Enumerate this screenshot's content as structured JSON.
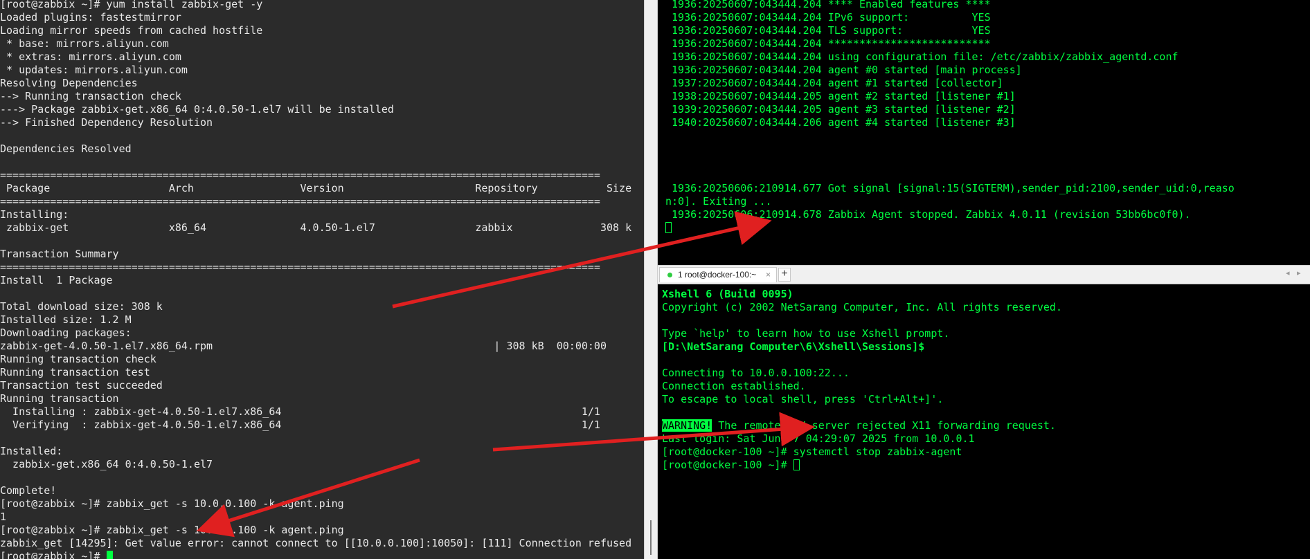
{
  "left_terminal": {
    "lines": [
      "[root@zabbix ~]# yum install zabbix-get -y",
      "Loaded plugins: fastestmirror",
      "Loading mirror speeds from cached hostfile",
      " * base: mirrors.aliyun.com",
      " * extras: mirrors.aliyun.com",
      " * updates: mirrors.aliyun.com",
      "Resolving Dependencies",
      "--> Running transaction check",
      "---> Package zabbix-get.x86_64 0:4.0.50-1.el7 will be installed",
      "--> Finished Dependency Resolution",
      "",
      "Dependencies Resolved",
      "",
      "================================================================================================",
      " Package                   Arch                 Version                     Repository           Size",
      "================================================================================================",
      "Installing:",
      " zabbix-get                x86_64               4.0.50-1.el7                zabbix              308 k",
      "",
      "Transaction Summary",
      "================================================================================================",
      "Install  1 Package",
      "",
      "Total download size: 308 k",
      "Installed size: 1.2 M",
      "Downloading packages:",
      "zabbix-get-4.0.50-1.el7.x86_64.rpm                                             | 308 kB  00:00:00",
      "Running transaction check",
      "Running transaction test",
      "Transaction test succeeded",
      "Running transaction",
      "  Installing : zabbix-get-4.0.50-1.el7.x86_64                                                1/1",
      "  Verifying  : zabbix-get-4.0.50-1.el7.x86_64                                                1/1",
      "",
      "Installed:",
      "  zabbix-get.x86_64 0:4.0.50-1.el7",
      "",
      "Complete!",
      "[root@zabbix ~]# zabbix_get -s 10.0.0.100 -k agent.ping",
      "1",
      "[root@zabbix ~]# zabbix_get -s 10.0.0.100 -k agent.ping",
      "zabbix_get [14295]: Get value error: cannot connect to [[10.0.0.100]:10050]: [111] Connection refused",
      "[root@zabbix ~]# "
    ]
  },
  "right_top_terminal": {
    "lines": [
      " 1936:20250607:043444.204 **** Enabled features ****",
      " 1936:20250607:043444.204 IPv6 support:          YES",
      " 1936:20250607:043444.204 TLS support:           YES",
      " 1936:20250607:043444.204 **************************",
      " 1936:20250607:043444.204 using configuration file: /etc/zabbix/zabbix_agentd.conf",
      " 1936:20250607:043444.204 agent #0 started [main process]",
      " 1937:20250607:043444.204 agent #1 started [collector]",
      " 1938:20250607:043444.205 agent #2 started [listener #1]",
      " 1939:20250607:043444.205 agent #3 started [listener #2]",
      " 1940:20250607:043444.206 agent #4 started [listener #3]",
      "",
      "",
      "",
      "",
      " 1936:20250606:210914.677 Got signal [signal:15(SIGTERM),sender_pid:2100,sender_uid:0,reaso",
      "n:0]. Exiting ...",
      " 1936:20250606:210914.678 Zabbix Agent stopped. Zabbix 4.0.11 (revision 53bb6bc0f0).",
      ""
    ]
  },
  "tab_bar": {
    "tab_label": "1 root@docker-100:~",
    "tab_close": "×",
    "add_tab": "+",
    "nav_prev": "◂",
    "nav_next": "▸"
  },
  "right_bottom_terminal": {
    "lines": [
      "Xshell 6 (Build 0095)",
      "Copyright (c) 2002 NetSarang Computer, Inc. All rights reserved.",
      "",
      "Type `help' to learn how to use Xshell prompt.",
      "[D:\\NetSarang Computer\\6\\Xshell\\Sessions]$",
      "",
      "Connecting to 10.0.0.100:22...",
      "Connection established.",
      "To escape to local shell, press 'Ctrl+Alt+]'.",
      "",
      " The remote SSH server rejected X11 forwarding request.",
      "Last login: Sat Jun  7 04:29:07 2025 from 10.0.0.1",
      "[root@docker-100 ~]# systemctl stop zabbix-agent",
      "[root@docker-100 ~]# "
    ],
    "warning_label": "WARNING!"
  },
  "colors": {
    "left_bg": "#2b2b2b",
    "left_text": "#e8e8e8",
    "right_bg": "#000000",
    "right_text": "#00ff41",
    "arrow": "#e02020"
  }
}
